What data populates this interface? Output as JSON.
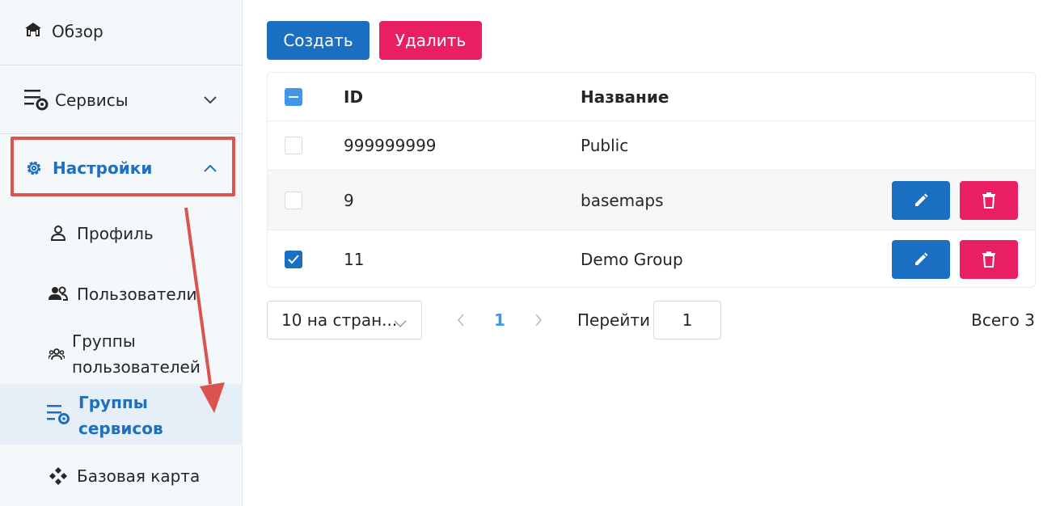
{
  "sidebar": {
    "overview": "Обзор",
    "services": "Сервисы",
    "settings": "Настройки",
    "sub_items": [
      {
        "label": "Профиль",
        "icon": "person-icon"
      },
      {
        "label": "Пользователи",
        "icon": "users-icon"
      },
      {
        "label": "Группы пользователей",
        "line1": "Группы",
        "line2": "пользователей",
        "icon": "user-groups-icon"
      },
      {
        "label": "Группы сервисов",
        "line1": "Группы",
        "line2": "сервисов",
        "icon": "service-settings-icon",
        "active": true
      },
      {
        "label": "Базовая карта",
        "icon": "basemap-icon"
      }
    ]
  },
  "toolbar": {
    "create_label": "Создать",
    "delete_label": "Удалить"
  },
  "table": {
    "columns": [
      "ID",
      "Название"
    ],
    "rows": [
      {
        "id": "999999999",
        "name": "Public",
        "checked": false
      },
      {
        "id": "9",
        "name": "basemaps",
        "checked": false
      },
      {
        "id": "11",
        "name": "Demo Group",
        "checked": true
      }
    ]
  },
  "pagination": {
    "page_size": "10 на стран...",
    "current_page": "1",
    "goto_label": "Перейти",
    "goto_value": "1",
    "total": "Всего 3"
  },
  "colors": {
    "primary": "#1b6fc2",
    "danger": "#e91e63",
    "active_text": "#1e6fbf",
    "annotation": "#d9534f"
  }
}
